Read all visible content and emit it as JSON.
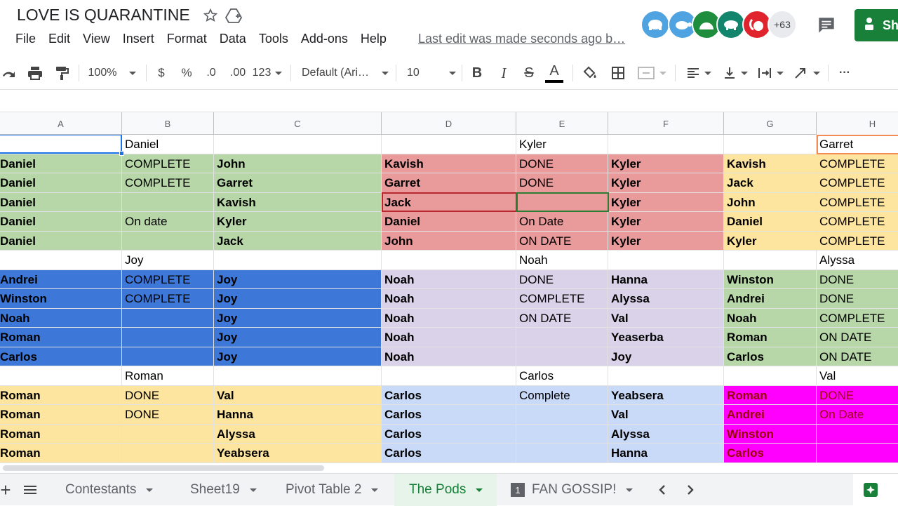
{
  "title": "LOVE IS QUARANTINE",
  "menu": [
    "File",
    "Edit",
    "View",
    "Insert",
    "Format",
    "Data",
    "Tools",
    "Add-ons",
    "Help"
  ],
  "last_edit": "Last edit was made seconds ago b…",
  "collaborators_more": "+63",
  "share_label": "Sh",
  "toolbar": {
    "zoom": "100%",
    "currency": "$",
    "percent": "%",
    "decimal_less": ".0",
    "decimal_more": ".00",
    "format_more": "123",
    "font": "Default (Ari…",
    "font_size": "10",
    "bold": "B",
    "italic": "I",
    "strike": "S",
    "text_color": "A",
    "more": "···"
  },
  "columns": [
    "A",
    "B",
    "C",
    "D",
    "E",
    "F",
    "G",
    "H"
  ],
  "colors": {
    "green": "#b7d7a8",
    "red": "#e99a9a",
    "yellow": "#fde49f",
    "blue": "#3d78d8",
    "lavender": "#d9d2e9",
    "lightblue": "#c9daf8",
    "magenta": "#ff00ff",
    "accent": "#188038",
    "magenta_text": "#990000"
  },
  "rows": [
    [
      "",
      "Daniel",
      "",
      "",
      "Kyler",
      "",
      "",
      "Garret"
    ],
    [
      "Daniel",
      "COMPLETE",
      "John",
      "Kavish",
      "DONE",
      "Kyler",
      "Kavish",
      "COMPLETE"
    ],
    [
      "Daniel",
      "COMPLETE",
      "Garret",
      "Garret",
      "DONE",
      "Kyler",
      "Jack",
      "COMPLETE"
    ],
    [
      "Daniel",
      "",
      "Kavish",
      "Jack",
      "",
      "Kyler",
      "John",
      "COMPLETE"
    ],
    [
      "Daniel",
      "On date",
      "Kyler",
      "Daniel",
      "On Date",
      "Kyler",
      "Daniel",
      "COMPLETE"
    ],
    [
      "Daniel",
      "",
      "Jack",
      "John",
      "ON DATE",
      "Kyler",
      "Kyler",
      "COMPLETE"
    ],
    [
      "",
      "Joy",
      "",
      "",
      "Noah",
      "",
      "",
      "Alyssa"
    ],
    [
      "Andrei",
      "COMPLETE",
      "Joy",
      "Noah",
      "DONE",
      "Hanna",
      "Winston",
      "DONE"
    ],
    [
      "Winston",
      "COMPLETE",
      "Joy",
      "Noah",
      "COMPLETE",
      "Alyssa",
      "Andrei",
      "DONE"
    ],
    [
      "Noah",
      "",
      "Joy",
      "Noah",
      "ON DATE",
      "Val",
      "Noah",
      "COMPLETE"
    ],
    [
      "Roman",
      "",
      "Joy",
      "Noah",
      "",
      "Yeaserba",
      "Roman",
      "ON DATE"
    ],
    [
      "Carlos",
      "",
      "Joy",
      "Noah",
      "",
      "Joy",
      "Carlos",
      "ON DATE"
    ],
    [
      "",
      "Roman",
      "",
      "",
      "Carlos",
      "",
      "",
      "Val"
    ],
    [
      "Roman",
      "DONE",
      "Val",
      "Carlos",
      "Complete",
      "Yeabsera",
      "Roman",
      "DONE"
    ],
    [
      "Roman",
      "DONE",
      "Hanna",
      "Carlos",
      "",
      "Val",
      "Andrei",
      "On Date"
    ],
    [
      "Roman",
      "",
      "Alyssa",
      "Carlos",
      "",
      "Alyssa",
      "Winston",
      ""
    ],
    [
      "Roman",
      "",
      "Yeabsera",
      "Carlos",
      "",
      "Hanna",
      "Carlos",
      ""
    ]
  ],
  "sheet_tabs": [
    "Contestants",
    "Sheet19",
    "Pivot Table 2",
    "The Pods",
    "FAN GOSSIP!"
  ],
  "active_tab": "The Pods",
  "fan_gossip_badge": "1"
}
